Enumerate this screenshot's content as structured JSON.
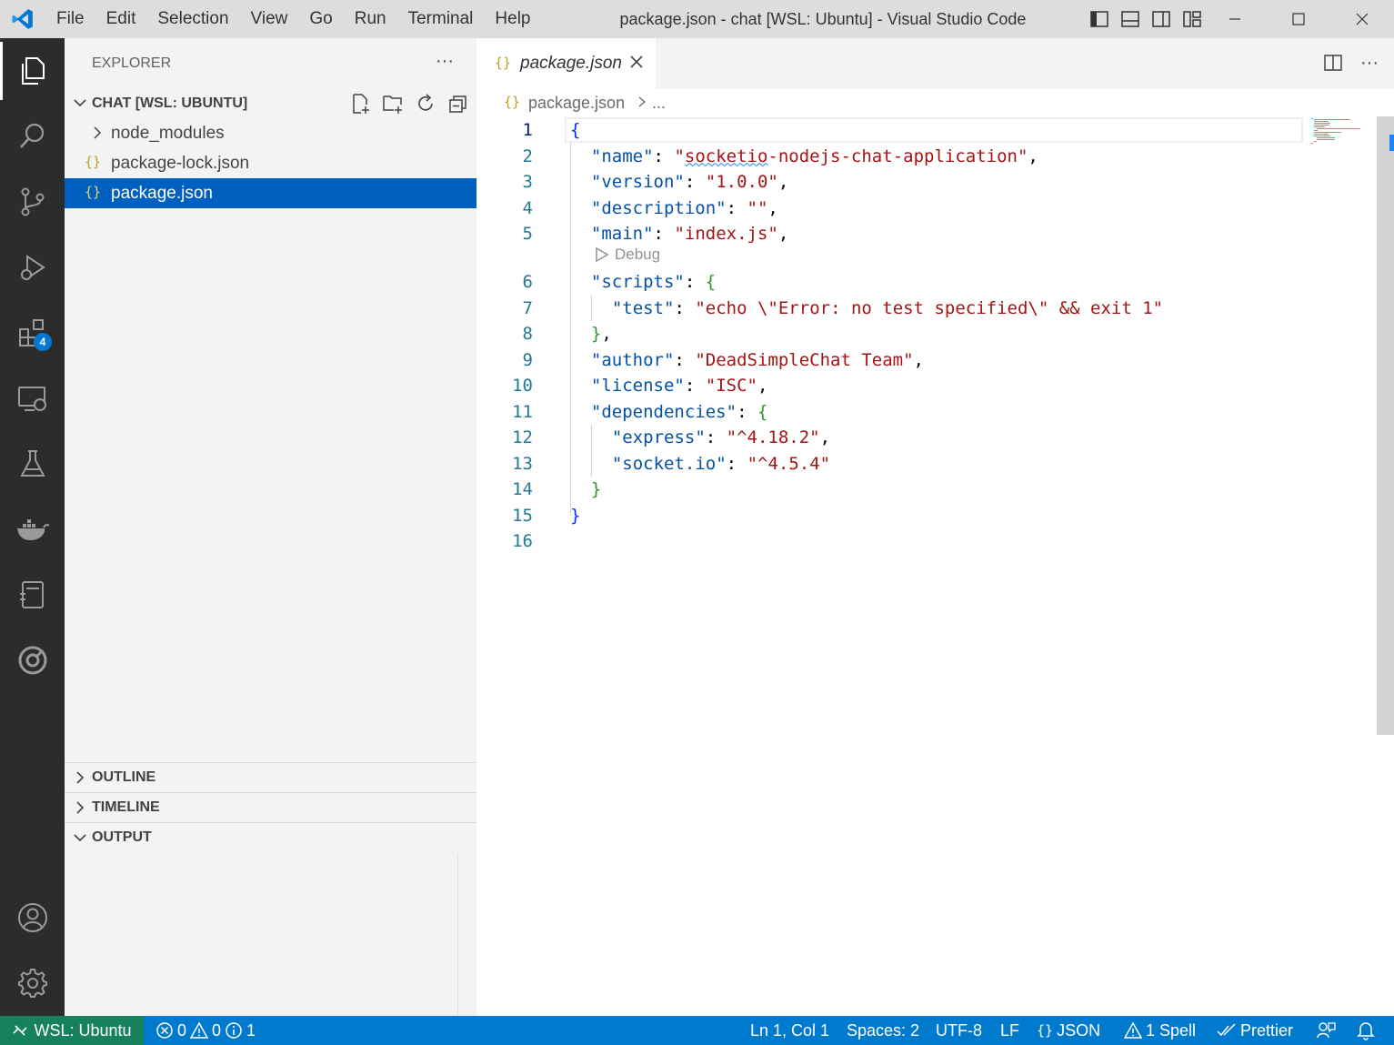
{
  "window": {
    "title": "package.json - chat [WSL: Ubuntu] - Visual Studio Code"
  },
  "menu": [
    "File",
    "Edit",
    "Selection",
    "View",
    "Go",
    "Run",
    "Terminal",
    "Help"
  ],
  "activity": {
    "extensions_badge": "4"
  },
  "sidebar": {
    "title": "EXPLORER",
    "more": "···",
    "folder": "CHAT [WSL: UBUNTU]",
    "items": [
      {
        "name": "node_modules",
        "type": "folder"
      },
      {
        "name": "package-lock.json",
        "type": "json"
      },
      {
        "name": "package.json",
        "type": "json"
      }
    ],
    "sections": [
      "OUTLINE",
      "TIMELINE",
      "OUTPUT"
    ]
  },
  "editor": {
    "tab_label": "package.json",
    "breadcrumb": "package.json",
    "breadcrumb_rest": "...",
    "json_glyph": "{}",
    "codelens": "Debug",
    "lines": [
      "{",
      "  \"name\": \"socketio-nodejs-chat-application\",",
      "  \"version\": \"1.0.0\",",
      "  \"description\": \"\",",
      "  \"main\": \"index.js\",",
      "  \"scripts\": {",
      "    \"test\": \"echo \\\"Error: no test specified\\\" && exit 1\"",
      "  },",
      "  \"author\": \"DeadSimpleChat Team\",",
      "  \"license\": \"ISC\",",
      "  \"dependencies\": {",
      "    \"express\": \"^4.18.2\",",
      "    \"socket.io\": \"^4.5.4\"",
      "  }",
      "}",
      ""
    ],
    "line_numbers": [
      "1",
      "2",
      "3",
      "4",
      "5",
      "6",
      "7",
      "8",
      "9",
      "10",
      "11",
      "12",
      "13",
      "14",
      "15",
      "16"
    ]
  },
  "status": {
    "remote": "WSL: Ubuntu",
    "errors": "0",
    "warnings": "0",
    "info": "1",
    "position": "Ln 1, Col 1",
    "spaces": "Spaces: 2",
    "encoding": "UTF-8",
    "eol": "LF",
    "language": "JSON",
    "spell": "1 Spell",
    "prettier": "Prettier"
  },
  "colors": {
    "accent": "#007acc",
    "remote": "#16825d",
    "selection": "#0060c0",
    "activitybar": "#2c2c2c"
  }
}
